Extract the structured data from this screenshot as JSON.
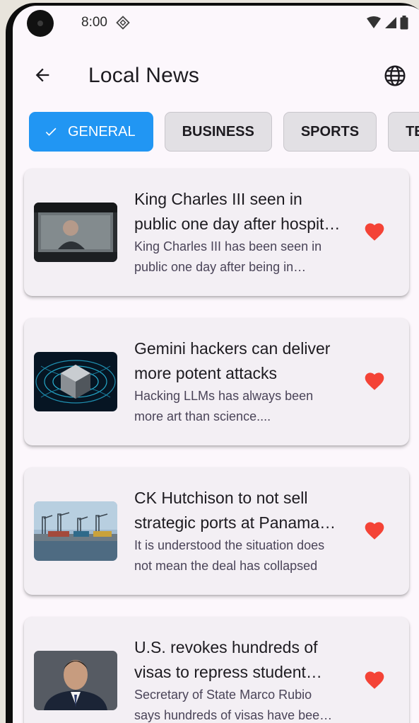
{
  "status_bar": {
    "time": "8:00",
    "icons": [
      "sync-icon",
      "wifi-icon",
      "signal-icon",
      "battery-icon"
    ]
  },
  "app_bar": {
    "title": "Local News",
    "back_icon": "arrow-back-icon",
    "action_icon": "globe-icon"
  },
  "categories": [
    {
      "label": "GENERAL",
      "selected": true
    },
    {
      "label": "BUSINESS",
      "selected": false
    },
    {
      "label": "SPORTS",
      "selected": false
    },
    {
      "label": "TECHNOLOGY",
      "selected": false
    }
  ],
  "articles": [
    {
      "title": "King Charles III seen in public one day after hospital visit",
      "description": "King Charles III has been seen in public one day after being in hospital",
      "favorite": true
    },
    {
      "title": "Gemini hackers can deliver more potent attacks",
      "description": "Hacking LLMs has always been more art than science....",
      "favorite": true
    },
    {
      "title": "CK Hutchison to not sell strategic ports at Panama Canal",
      "description": "It is understood the situation does not mean the deal has collapsed",
      "favorite": true
    },
    {
      "title": "U.S. revokes hundreds of visas to repress student activism",
      "description": "Secretary of State Marco Rubio says hundreds of visas have been revoked",
      "favorite": true
    }
  ],
  "colors": {
    "accent": "#2196f3",
    "favorite": "#f44336",
    "background": "#fcf7fc",
    "card": "#f3eff4"
  }
}
